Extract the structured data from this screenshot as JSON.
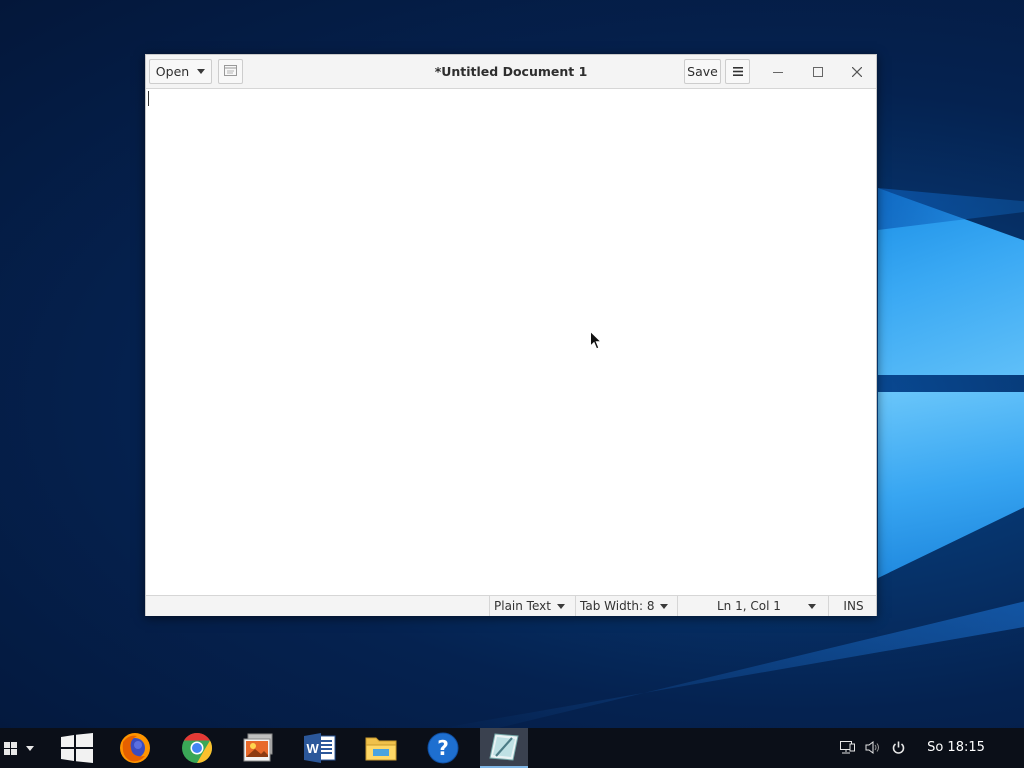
{
  "window": {
    "title": "*Untitled Document 1",
    "open_label": "Open",
    "save_label": "Save",
    "menu_symbol": "≡"
  },
  "editor": {
    "content": ""
  },
  "statusbar": {
    "language": "Plain Text",
    "tab_width": "Tab Width: 8",
    "position": "Ln 1, Col 1",
    "mode": "INS"
  },
  "taskbar": {
    "apps": [
      {
        "icon": "windows-logo-icon"
      },
      {
        "icon": "firefox-icon"
      },
      {
        "icon": "chrome-icon"
      },
      {
        "icon": "photos-icon"
      },
      {
        "icon": "word-icon"
      },
      {
        "icon": "file-explorer-icon"
      },
      {
        "icon": "help-icon"
      },
      {
        "icon": "text-editor-icon",
        "active": true
      }
    ],
    "tray_icons": [
      "network-icon",
      "volume-icon",
      "power-icon"
    ],
    "clock": "So 18:15"
  },
  "colors": {
    "accent": "#1a82da",
    "taskbar_bg": "#0b0f18",
    "desktop_bg": "#052250"
  }
}
